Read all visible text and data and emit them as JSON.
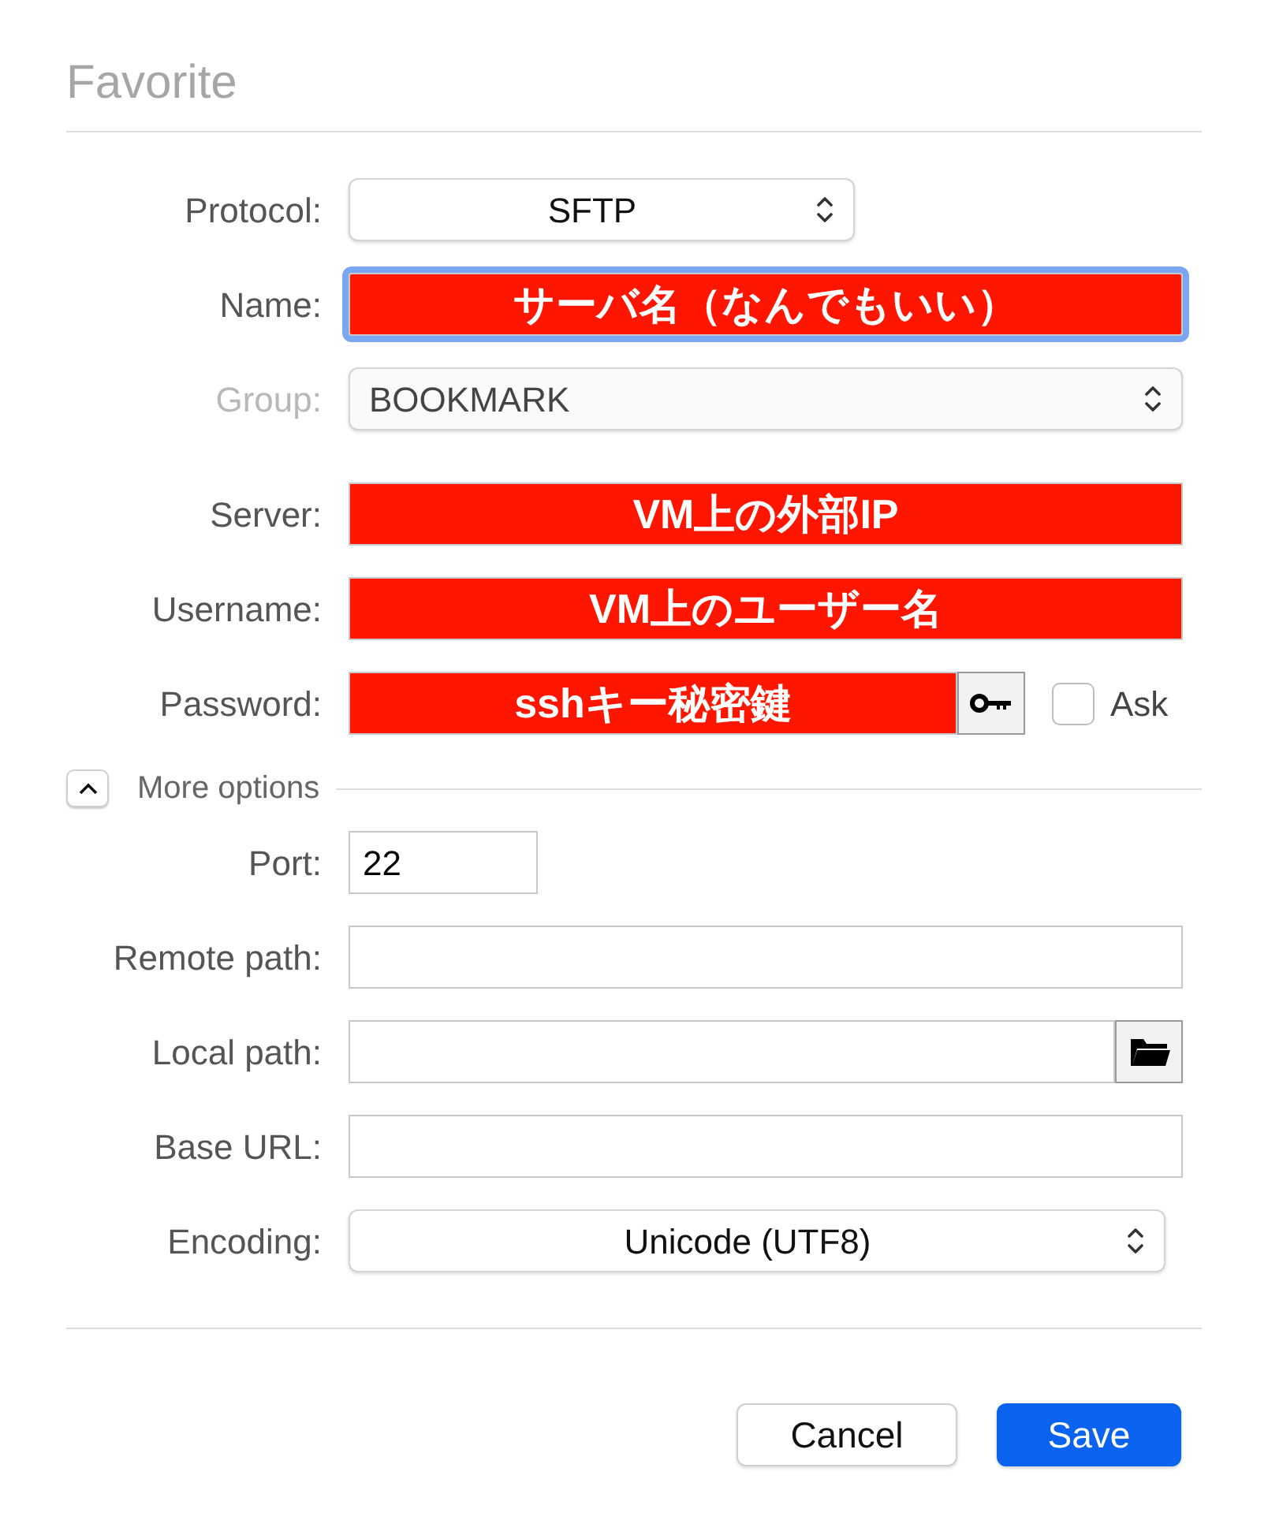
{
  "title": "Favorite",
  "fields": [
    {
      "kind": "select-short",
      "label": "Protocol:",
      "value": "SFTP"
    },
    {
      "kind": "text",
      "label": "Name:",
      "value": "サーバ名（なんでもいい）",
      "redacted": true,
      "focused": true
    },
    {
      "kind": "select-left",
      "label": "Group:",
      "value": "BOOKMARK",
      "disabled": true
    },
    {
      "kind": "text",
      "label": "Server:",
      "value": "VM上の外部IP",
      "redacted": true
    },
    {
      "kind": "text",
      "label": "Username:",
      "value": "VM上のユーザー名",
      "redacted": true
    },
    {
      "kind": "password",
      "label": "Password:",
      "value": "sshキー秘密鍵",
      "redacted": true,
      "ask_label": "Ask",
      "ask_checked": false
    }
  ],
  "more_options": {
    "label": "More options",
    "expanded": true
  },
  "options": [
    {
      "kind": "text-short",
      "label": "Port:",
      "value": "22"
    },
    {
      "kind": "text",
      "label": "Remote path:"
    },
    {
      "kind": "folder",
      "label": "Local path:"
    },
    {
      "kind": "text",
      "label": "Base URL:"
    },
    {
      "kind": "select",
      "label": "Encoding:",
      "value": "Unicode (UTF8)"
    }
  ],
  "buttons": [
    {
      "label": "Cancel",
      "primary": false
    },
    {
      "label": "Save",
      "primary": true
    }
  ]
}
